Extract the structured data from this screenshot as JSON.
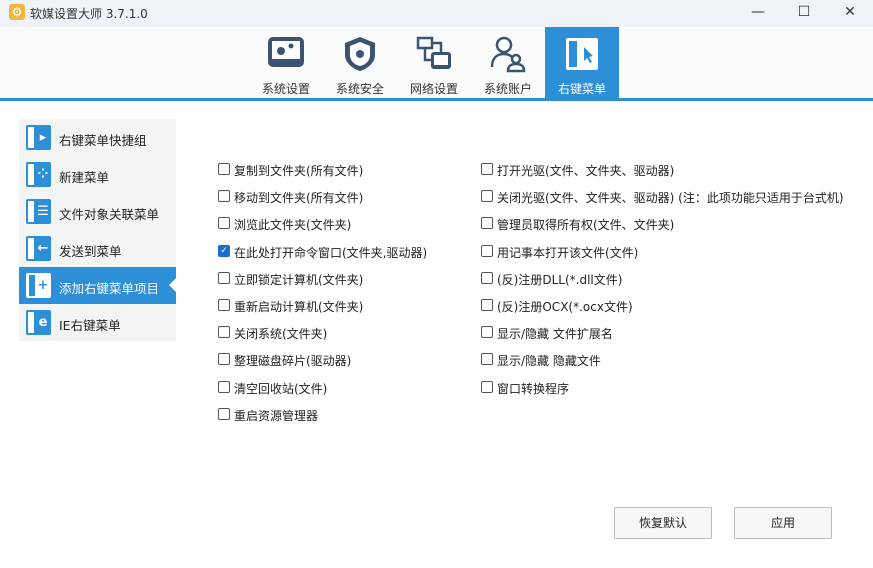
{
  "window": {
    "title": "软媒设置大师 3.7.1.0",
    "minimize": "—",
    "maximize": "☐",
    "close": "✕"
  },
  "tabs": [
    {
      "label": "系统设置",
      "icon": "monitor-gear-icon"
    },
    {
      "label": "系统安全",
      "icon": "shield-gear-icon"
    },
    {
      "label": "网络设置",
      "icon": "network-icon"
    },
    {
      "label": "系统账户",
      "icon": "users-icon"
    },
    {
      "label": "右键菜单",
      "icon": "right-click-menu-icon",
      "active": true
    }
  ],
  "sidebar": {
    "items": [
      {
        "label": "右键菜单快捷组",
        "glyph": "▸"
      },
      {
        "label": "新建菜单",
        "glyph": "⁘"
      },
      {
        "label": "文件对象关联菜单",
        "glyph": "☰"
      },
      {
        "label": "发送到菜单",
        "glyph": "←"
      },
      {
        "label": "添加右键菜单项目",
        "glyph": "+",
        "active": true
      },
      {
        "label": "IE右键菜单",
        "glyph": "e"
      }
    ]
  },
  "options": {
    "left": [
      {
        "label": "复制到文件夹(所有文件)",
        "checked": false
      },
      {
        "label": "移动到文件夹(所有文件)",
        "checked": false
      },
      {
        "label": "浏览此文件夹(文件夹)",
        "checked": false
      },
      {
        "label": "在此处打开命令窗口(文件夹,驱动器)",
        "checked": true
      },
      {
        "label": "立即锁定计算机(文件夹)",
        "checked": false
      },
      {
        "label": "重新启动计算机(文件夹)",
        "checked": false
      },
      {
        "label": "关闭系统(文件夹)",
        "checked": false
      },
      {
        "label": "整理磁盘碎片(驱动器)",
        "checked": false
      },
      {
        "label": "清空回收站(文件)",
        "checked": false
      },
      {
        "label": "重启资源管理器",
        "checked": false
      }
    ],
    "right": [
      {
        "label": "打开光驱(文件、文件夹、驱动器)",
        "checked": false
      },
      {
        "label": "关闭光驱(文件、文件夹、驱动器)  (注：此项功能只适用于台式机)",
        "checked": false
      },
      {
        "label": "管理员取得所有权(文件、文件夹)",
        "checked": false
      },
      {
        "label": "用记事本打开该文件(文件)",
        "checked": false
      },
      {
        "label": "(反)注册DLL(*.dll文件)",
        "checked": false
      },
      {
        "label": "(反)注册OCX(*.ocx文件)",
        "checked": false
      },
      {
        "label": "显示/隐藏 文件扩展名",
        "checked": false
      },
      {
        "label": "显示/隐藏 隐藏文件",
        "checked": false
      },
      {
        "label": "窗口转换程序",
        "checked": false
      }
    ]
  },
  "buttons": {
    "restore": "恢复默认",
    "apply": "应用"
  },
  "colors": {
    "accent": "#2d8fd8",
    "icon": "#3d5470"
  }
}
